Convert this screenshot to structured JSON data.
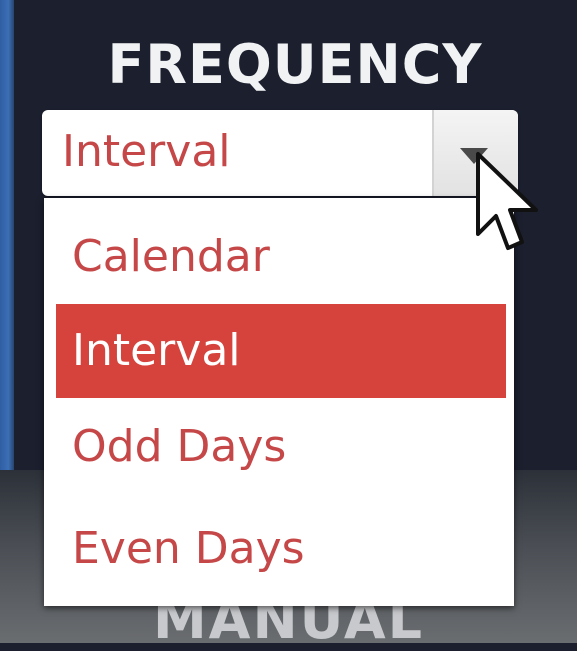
{
  "frequency": {
    "title": "FREQUENCY",
    "selected_value": "Interval",
    "dropdown_icon": "chevron-down-icon",
    "options": [
      {
        "label": "Calendar",
        "selected": false
      },
      {
        "label": "Interval",
        "selected": true
      },
      {
        "label": "Odd Days",
        "selected": false
      },
      {
        "label": "Even Days",
        "selected": false
      }
    ]
  },
  "background": {
    "bottom_label": "MANUAL"
  },
  "colors": {
    "accent": "#d6433d",
    "option_text": "#c64747",
    "panel_bg": "#1b1f2e",
    "heading_text": "#f1f2f4"
  },
  "cursor": {
    "icon": "mouse-pointer-icon"
  }
}
